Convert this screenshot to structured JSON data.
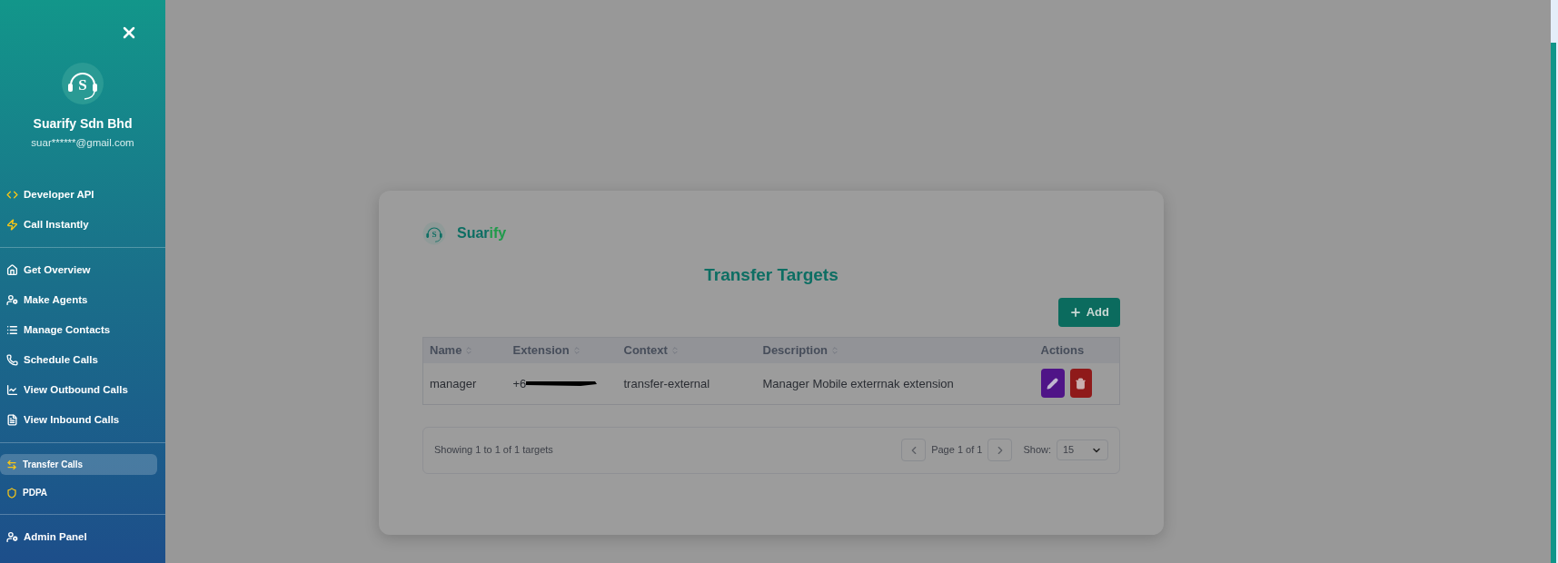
{
  "sidebar": {
    "profile": {
      "logo_letter": "S",
      "name": "Suarify Sdn Bhd",
      "email": "suar******@gmail.com"
    },
    "groups": [
      {
        "items": [
          {
            "label": "Developer API",
            "selected": false
          },
          {
            "label": "Call Instantly",
            "selected": false
          }
        ]
      },
      {
        "items": [
          {
            "label": "Get Overview",
            "selected": false
          },
          {
            "label": "Make Agents",
            "selected": false
          },
          {
            "label": "Manage Contacts",
            "selected": false
          },
          {
            "label": "Schedule Calls",
            "selected": false
          },
          {
            "label": "View Outbound Calls",
            "selected": false
          },
          {
            "label": "View Inbound Calls",
            "selected": false
          }
        ]
      },
      {
        "items": [
          {
            "label": "Transfer Calls",
            "selected": true
          },
          {
            "label": "PDPA",
            "selected": false
          }
        ]
      },
      {
        "items": [
          {
            "label": "Admin Panel",
            "selected": false
          }
        ]
      }
    ]
  },
  "card": {
    "brand": {
      "logo_letter": "S",
      "main": "Suar",
      "accent": "ify"
    },
    "title": "Transfer Targets",
    "add_button": "Add",
    "table": {
      "columns": [
        {
          "label": "Name",
          "sortable": true
        },
        {
          "label": "Extension",
          "sortable": true
        },
        {
          "label": "Context",
          "sortable": true
        },
        {
          "label": "Description",
          "sortable": true
        },
        {
          "label": "Actions",
          "sortable": false
        }
      ],
      "rows": [
        {
          "name": "manager",
          "extension": "+6",
          "extension_redacted": true,
          "context": "transfer-external",
          "description": "Manager Mobile exterrnak extension"
        }
      ]
    },
    "footer": {
      "summary": "Showing 1 to 1 of 1 targets",
      "page": "Page 1 of 1",
      "show_label": "Show:",
      "page_size": "15"
    }
  }
}
